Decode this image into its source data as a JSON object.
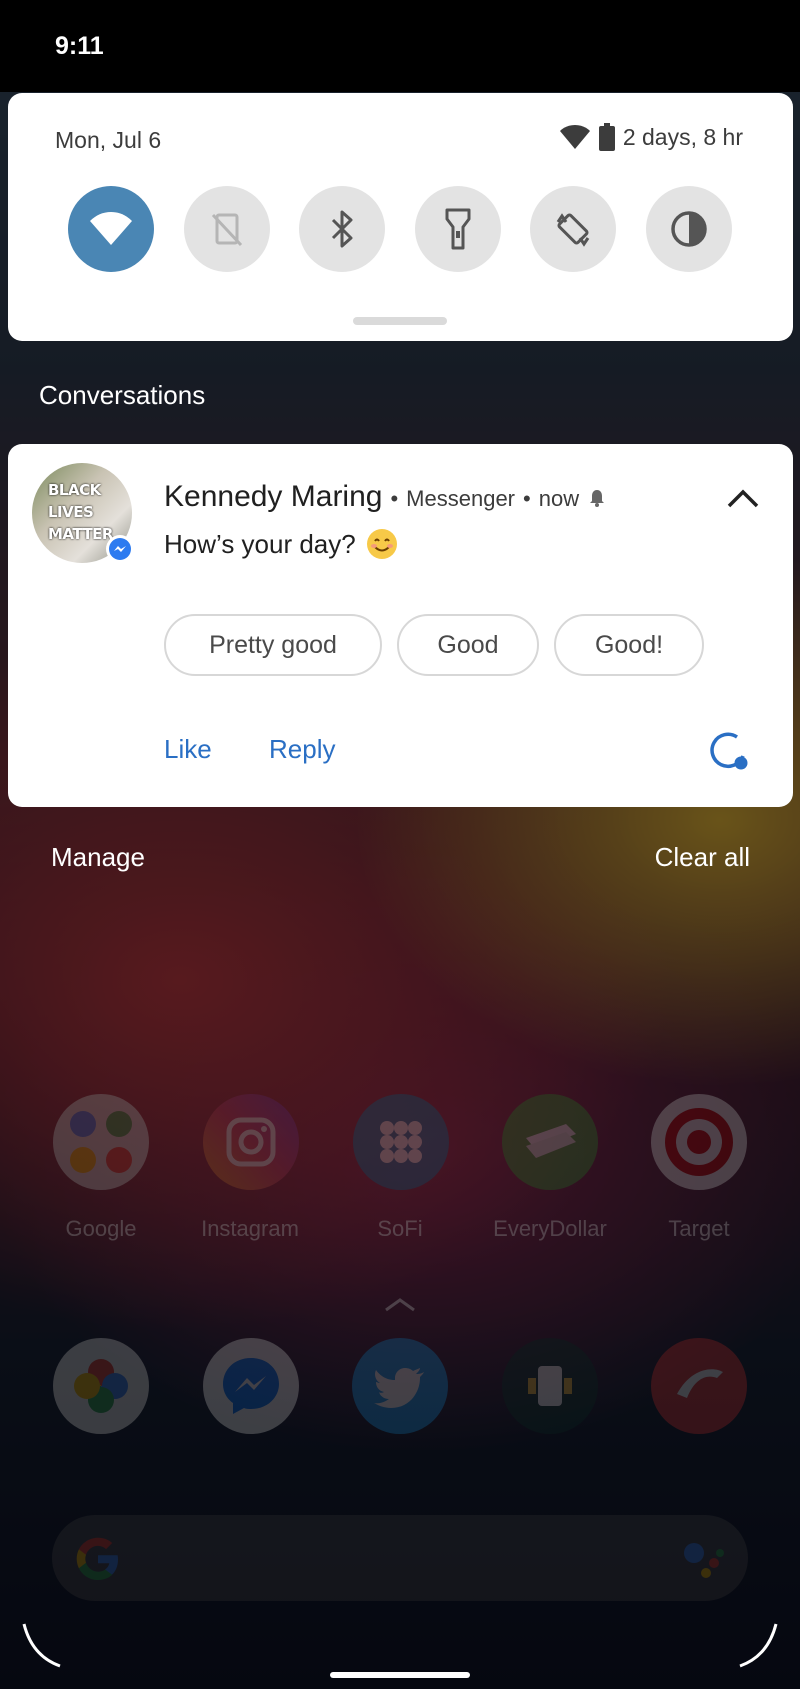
{
  "status_bar": {
    "time": "9:11"
  },
  "quick_settings": {
    "date": "Mon, Jul 6",
    "battery_text": "2 days, 8 hr",
    "tiles": [
      {
        "name": "wifi",
        "active": true
      },
      {
        "name": "auto-rotate-off",
        "active": false
      },
      {
        "name": "bluetooth",
        "active": false
      },
      {
        "name": "flashlight",
        "active": false
      },
      {
        "name": "auto-rotate",
        "active": false
      },
      {
        "name": "dark-theme",
        "active": false
      }
    ]
  },
  "section": {
    "title": "Conversations"
  },
  "notification": {
    "avatar_text": "BLACK\nLIVES\nMATTER",
    "sender": "Kennedy Maring",
    "app": "Messenger",
    "time": "now",
    "separator": "•",
    "message": "How’s your day?",
    "smart_replies": [
      "Pretty good",
      "Good",
      "Good!"
    ],
    "actions": {
      "like": "Like",
      "reply": "Reply"
    }
  },
  "footer": {
    "manage": "Manage",
    "clear_all": "Clear all"
  },
  "home_apps": [
    {
      "label": "Google",
      "color": "#d8d8d8"
    },
    {
      "label": "Instagram",
      "color": "#d4456a"
    },
    {
      "label": "SoFi",
      "color": "#1d7fa8"
    },
    {
      "label": "EveryDollar",
      "color": "#3fa73f"
    },
    {
      "label": "Target",
      "color": "#ffffff"
    }
  ],
  "dock_apps": [
    {
      "name": "photos",
      "color": "#f2f2f2"
    },
    {
      "name": "messenger",
      "color": "#ffffff"
    },
    {
      "name": "twitter",
      "color": "#1da1f2"
    },
    {
      "name": "phone-app",
      "color": "#123a34"
    },
    {
      "name": "red-app",
      "color": "#e23a3a"
    }
  ]
}
